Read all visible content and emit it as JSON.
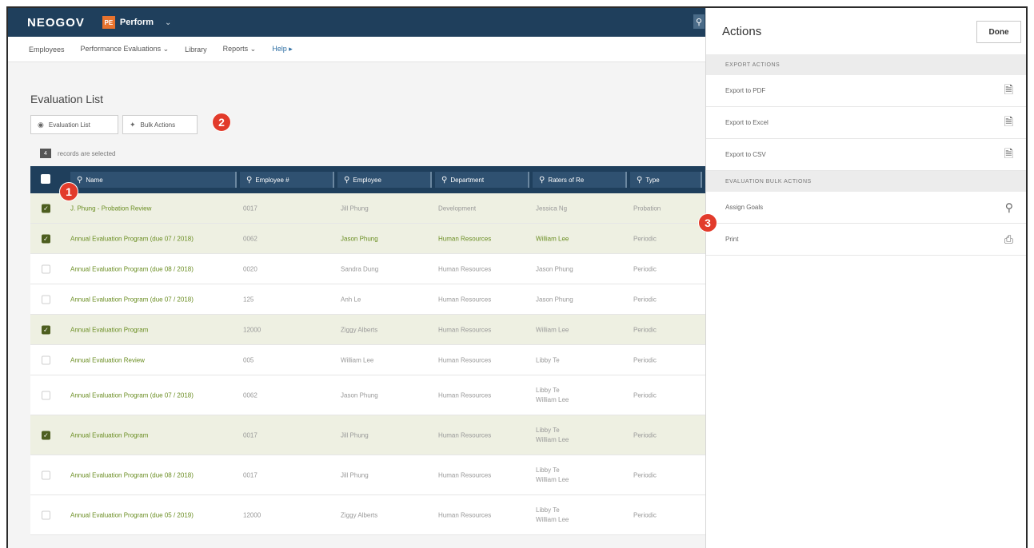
{
  "topbar": {
    "logo": "NEOGOV",
    "product_badge": "PE",
    "product": "Perform",
    "product_chevron": "⌄",
    "search_icon": "search-icon"
  },
  "subnav": {
    "items": [
      "Employees",
      "Performance Evaluations ⌄",
      "Library",
      "Reports ⌄",
      "Help ▸"
    ]
  },
  "page": {
    "title": "Evaluation List",
    "evaluation_list_button": "Evaluation List",
    "bulk_actions_button": "Bulk Actions",
    "selected_count": "4",
    "selected_text": "records are selected"
  },
  "table": {
    "columns": [
      "Name",
      "Employee #",
      "Employee",
      "Department",
      "Raters of Re",
      "Type"
    ],
    "rows": [
      {
        "checked": true,
        "name": "J. Phung - Probation Review",
        "num": "0017",
        "employee": "Jill Phung",
        "dept": "Development",
        "raters": "Jessica Ng",
        "type": "Probation"
      },
      {
        "checked": true,
        "name": "Annual Evaluation Program (due 07 / 2018)",
        "num": "0062",
        "employee": "Jason Phung",
        "dept": "Human Resources",
        "raters": "William Lee",
        "type": "Periodic"
      },
      {
        "checked": false,
        "name": "Annual Evaluation Program (due 08 / 2018)",
        "num": "0020",
        "employee": "Sandra Dung",
        "dept": "Human Resources",
        "raters": "Jason Phung",
        "type": "Periodic"
      },
      {
        "checked": false,
        "name": "Annual Evaluation Program (due 07 / 2018)",
        "num": "125",
        "employee": "Anh Le",
        "dept": "Human Resources",
        "raters": "Jason Phung",
        "type": "Periodic"
      },
      {
        "checked": true,
        "name": "Annual Evaluation Program",
        "num": "12000",
        "employee": "Ziggy Alberts",
        "dept": "Human Resources",
        "raters": "William Lee",
        "type": "Periodic"
      },
      {
        "checked": false,
        "name": "Annual Evaluation Review",
        "num": "005",
        "employee": "William Lee",
        "dept": "Human Resources",
        "raters": "Libby Te",
        "type": "Periodic"
      },
      {
        "checked": false,
        "name": "Annual Evaluation Program (due 07 / 2018)",
        "num": "0062",
        "employee": "Jason Phung",
        "dept": "Human Resources",
        "raters": "Libby Te",
        "raters2": "William Lee",
        "type": "Periodic"
      },
      {
        "checked": true,
        "name": "Annual Evaluation Program",
        "num": "0017",
        "employee": "Jill Phung",
        "dept": "Human Resources",
        "raters": "Libby Te",
        "raters2": "William Lee",
        "type": "Periodic"
      },
      {
        "checked": false,
        "name": "Annual Evaluation Program (due 08 / 2018)",
        "num": "0017",
        "employee": "Jill Phung",
        "dept": "Human Resources",
        "raters": "Libby Te",
        "raters2": "William Lee",
        "type": "Periodic"
      },
      {
        "checked": false,
        "name": "Annual Evaluation Program (due 05 / 2019)",
        "num": "12000",
        "employee": "Ziggy Alberts",
        "dept": "Human Resources",
        "raters": "Libby Te",
        "raters2": "William Lee",
        "type": "Periodic"
      }
    ]
  },
  "panel": {
    "title": "Actions",
    "done": "Done",
    "export_section": "EXPORT ACTIONS",
    "export_pdf": "Export to PDF",
    "export_excel": "Export to Excel",
    "export_csv": "Export to CSV",
    "bulk_section": "EVALUATION BULK ACTIONS",
    "assign_goals": "Assign Goals",
    "print": "Print"
  },
  "callouts": {
    "one": "1",
    "two": "2",
    "three": "3"
  }
}
